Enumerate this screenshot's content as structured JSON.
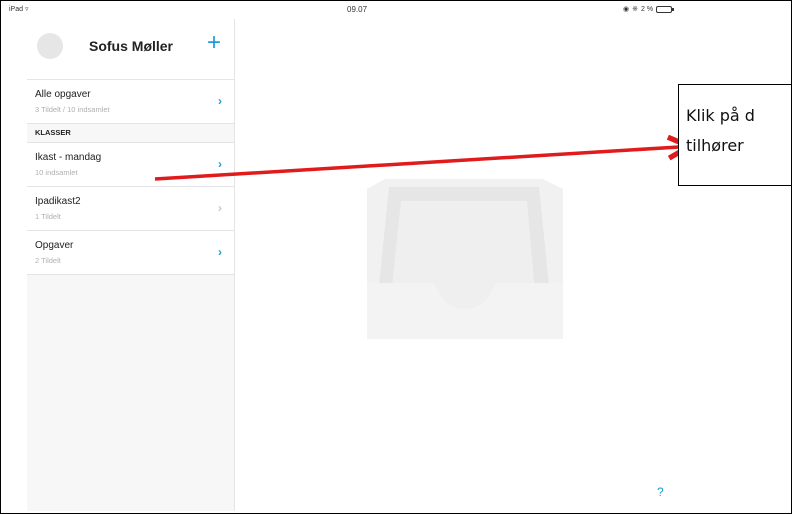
{
  "status_bar": {
    "device": "iPad",
    "time": "09.07",
    "battery": "2 %"
  },
  "sidebar": {
    "user_name": "Sofus Møller",
    "add_label": "+",
    "all_tasks": {
      "title": "Alle opgaver",
      "subtitle": "3 Tildelt / 10 indsamlet"
    },
    "section_title": "KLASSER",
    "classes": [
      {
        "title": "Ikast - mandag",
        "subtitle": "10 indsamlet"
      },
      {
        "title": "Ipadikast2",
        "subtitle": "1 Tildelt"
      },
      {
        "title": "Opgaver",
        "subtitle": "2 Tildelt"
      }
    ]
  },
  "main": {
    "help_label": "?"
  },
  "callout": {
    "line1": "Klik på d",
    "line2": "tilhører"
  },
  "colors": {
    "accent": "#1f9bd8",
    "arrow": "#e11b1b"
  }
}
